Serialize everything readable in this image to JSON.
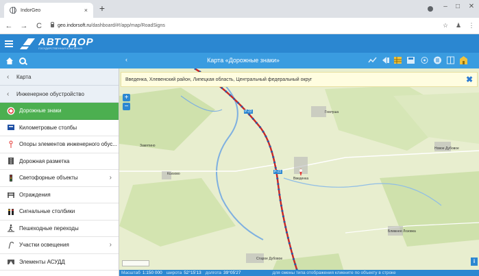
{
  "browser": {
    "tab_title": "IndorGeo",
    "tab_close": "×",
    "new_tab": "+",
    "window_controls": [
      "–",
      "□",
      "✕"
    ],
    "nav": {
      "back": "←",
      "forward": "→",
      "reload": "C"
    },
    "url_host": "geo.indorsoft.ru",
    "url_path": "/dashboard/#!/app/map/RoadSigns",
    "toolbar_icons": [
      "☆",
      "♟",
      "⋮"
    ]
  },
  "app": {
    "logo_text": "АВТОДОР",
    "logo_subtitle": "ГОСУДАРСТВЕННАЯ КОМПАНИЯ",
    "back": "‹",
    "map_title": "Карта «Дорожные знаки»"
  },
  "sidebar": {
    "top": [
      {
        "label": "Карта",
        "chev": "‹"
      },
      {
        "label": "Инженерное обустройство",
        "chev": "‹"
      }
    ],
    "items": [
      {
        "label": "Дорожные знаки",
        "icon": "road-sign-icon",
        "active": true,
        "arrow": ""
      },
      {
        "label": "Километровые столбы",
        "icon": "km-post-icon",
        "active": false,
        "arrow": ""
      },
      {
        "label": "Опоры элементов инженерного обус...",
        "icon": "support-icon",
        "active": false,
        "arrow": ""
      },
      {
        "label": "Дорожная разметка",
        "icon": "marking-icon",
        "active": false,
        "arrow": ""
      },
      {
        "label": "Светофорные объекты",
        "icon": "traffic-light-icon",
        "active": false,
        "arrow": "›"
      },
      {
        "label": "Ограждения",
        "icon": "fence-icon",
        "active": false,
        "arrow": ""
      },
      {
        "label": "Сигнальные столбики",
        "icon": "signal-post-icon",
        "active": false,
        "arrow": ""
      },
      {
        "label": "Пешеходные переходы",
        "icon": "pedestrian-icon",
        "active": false,
        "arrow": ""
      },
      {
        "label": "Участки освещения",
        "icon": "lighting-icon",
        "active": false,
        "arrow": "›"
      },
      {
        "label": "Элементы АСУДД",
        "icon": "asudd-icon",
        "active": false,
        "arrow": ""
      }
    ]
  },
  "map": {
    "address": "Введенка, Хлевенский район, Липецкая область, Центральный федеральный округ",
    "address_clear": "✖",
    "zoom_in": "+",
    "zoom_out": "−",
    "info": "i",
    "places": [
      "Замятино",
      "Гнилуша",
      "Новое Дубовое",
      "Ксизово",
      "Введенка",
      "Ближнее Лозовка",
      "Старое Дубовое"
    ],
    "road_labels": [
      "Р-22",
      "Р-22"
    ],
    "status": {
      "scale_label": "Масштаб",
      "scale_value": "1:150 000",
      "lat_label": "широта",
      "lat_value": "52°15'13",
      "lon_label": "долгота",
      "lon_value": "39°05'27",
      "hint": "для смены типа отображения кликните по объекту в строке"
    }
  }
}
